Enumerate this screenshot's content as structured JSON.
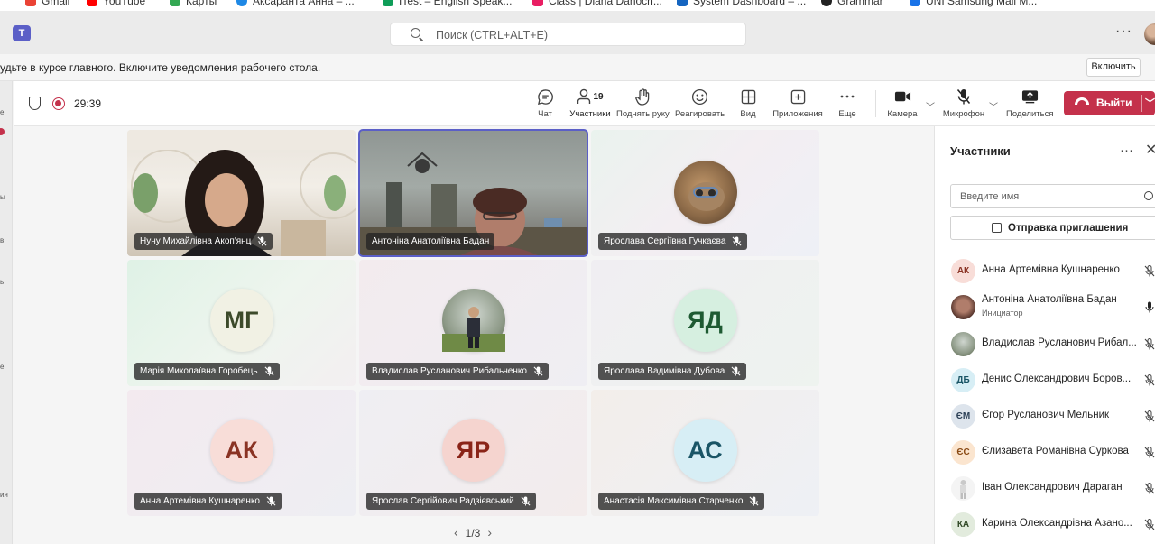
{
  "bookmarks": [
    "Gmail",
    "YouTube",
    "Карты",
    "Аксаранта Анна – ...",
    "ITest – English Speak...",
    "Class | Diana Danoch...",
    "System Dashboard – ...",
    "Grammar",
    "UNI Samsung Mail M..."
  ],
  "titlebar": {
    "search_placeholder": "Поиск (CTRL+ALT+E)",
    "more": "···"
  },
  "notification": {
    "text": "удьте в курсе главного. Включите уведомления рабочего стола.",
    "button": "Включить"
  },
  "leftrail_labels": [
    "е",
    "ы",
    "в",
    "ь",
    "е",
    "ия"
  ],
  "meeting": {
    "timer": "29:39",
    "participant_count": "19",
    "tools": {
      "chat": "Чат",
      "participants": "Участники",
      "raise_hand": "Поднять руку",
      "react": "Реагировать",
      "view": "Вид",
      "apps": "Приложения",
      "more": "Еще",
      "camera": "Камера",
      "mic": "Микрофон",
      "share": "Поделиться"
    },
    "leave": "Выйти"
  },
  "tiles": [
    {
      "name": "Нуну Михайлівна Акоп'янц",
      "initials": "",
      "muted": true,
      "kind": "video-woman"
    },
    {
      "name": "Антоніна Анатоліївна Бадан",
      "initials": "",
      "muted": false,
      "kind": "video-room"
    },
    {
      "name": "Ярослава Сергіївна Гучкаєва",
      "initials": "",
      "muted": true,
      "kind": "photo-cat"
    },
    {
      "name": "Марія Миколаївна Горобець",
      "initials": "МГ",
      "muted": true,
      "kind": "initials"
    },
    {
      "name": "Владислав Русланович Рибальченко",
      "initials": "",
      "muted": true,
      "kind": "photo-man"
    },
    {
      "name": "Ярослава Вадимівна Дубова",
      "initials": "ЯД",
      "muted": true,
      "kind": "initials"
    },
    {
      "name": "Анна Артемівна Кушнаренко",
      "initials": "АК",
      "muted": true,
      "kind": "initials"
    },
    {
      "name": "Ярослав Сергійович Радзієвський",
      "initials": "ЯР",
      "muted": true,
      "kind": "initials"
    },
    {
      "name": "Анастасія Максимівна Старченко",
      "initials": "АС",
      "muted": true,
      "kind": "initials"
    }
  ],
  "pager": {
    "label": "1/3"
  },
  "panel": {
    "title": "Участники",
    "search_placeholder": "Введите имя",
    "invite": "Отправка приглашения",
    "people": [
      {
        "name": "Анна Артемівна Кушнаренко",
        "initials": "АК",
        "role": "",
        "muted": true
      },
      {
        "name": "Антоніна Анатоліївна Бадан",
        "initials": "",
        "role": "Инициатор",
        "muted": false
      },
      {
        "name": "Владислав Русланович Рибал...",
        "initials": "",
        "role": "",
        "muted": true
      },
      {
        "name": "Денис Олександрович Боров...",
        "initials": "ДБ",
        "role": "",
        "muted": true
      },
      {
        "name": "Єгор Русланович Мельник",
        "initials": "ЄМ",
        "role": "",
        "muted": true
      },
      {
        "name": "Єлизавета Романівна Суркова",
        "initials": "ЄС",
        "role": "",
        "muted": true
      },
      {
        "name": "Іван Олександрович Дараган",
        "initials": "",
        "role": "",
        "muted": true
      },
      {
        "name": "Карина Олександрівна Азано...",
        "initials": "КА",
        "role": "",
        "muted": true
      }
    ]
  },
  "colors": {
    "accent": "#5b5fc7",
    "leave": "#c4314b"
  }
}
